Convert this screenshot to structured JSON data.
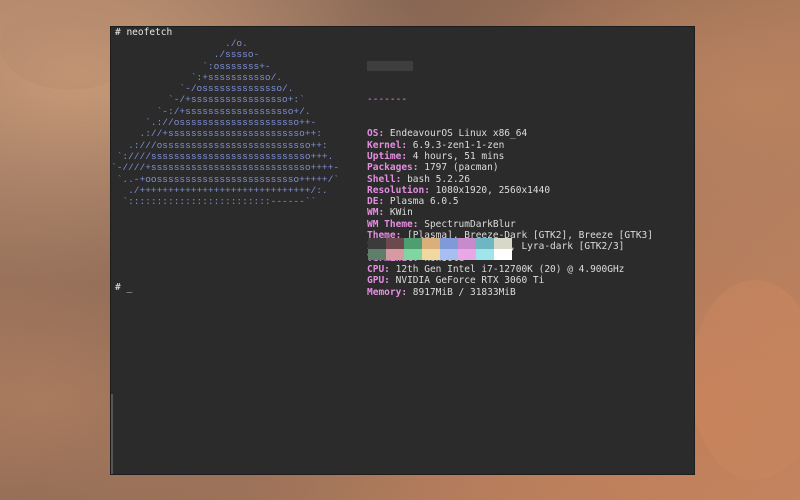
{
  "terminal": {
    "command_line": "# neofetch",
    "prompt_line": "# _"
  },
  "ascii_logo": "                    ./o.\n                  ./sssso-\n                `:osssssss+-\n              `:+sssssssssso/.\n            `-/ossssssssssssso/.\n          `-/+sssssssssssssssso+:`\n        `-:/+sssssssssssssssssso+/.\n      `.://osssssssssssssssssssso++-\n     .://+ssssssssssssssssssssssso++:\n   .:///ossssssssssssssssssssssssso++:\n `:////ssssssssssssssssssssssssssso+++.\n`-////+ssssssssssssssssssssssssssso++++-\n `..-+oosssssssssssssssssssssssso+++++/`\n   ./++++++++++++++++++++++++++++++/:.\n  `:::::::::::::::::::::::::------``",
  "info": {
    "host_separator": "-------",
    "rows": [
      {
        "key": "OS",
        "value": "EndeavourOS Linux x86_64"
      },
      {
        "key": "Kernel",
        "value": "6.9.3-zen1-1-zen"
      },
      {
        "key": "Uptime",
        "value": "4 hours, 51 mins"
      },
      {
        "key": "Packages",
        "value": "1797 (pacman)"
      },
      {
        "key": "Shell",
        "value": "bash 5.2.26"
      },
      {
        "key": "Resolution",
        "value": "1080x1920, 2560x1440"
      },
      {
        "key": "DE",
        "value": "Plasma 6.0.5"
      },
      {
        "key": "WM",
        "value": "KWin"
      },
      {
        "key": "WM Theme",
        "value": "SpectrumDarkBlur"
      },
      {
        "key": "Theme",
        "value": "[Plasma], Breeze-Dark [GTK2], Breeze [GTK3]"
      },
      {
        "key": "Icons",
        "value": "Lyra-dark [Plasma], Lyra-dark [GTK2/3]"
      },
      {
        "key": "Terminal",
        "value": "konsole"
      },
      {
        "key": "CPU",
        "value": "12th Gen Intel i7-12700K (20) @ 4.900GHz"
      },
      {
        "key": "GPU",
        "value": "NVIDIA GeForce RTX 3060 Ti"
      },
      {
        "key": "Memory",
        "value": "8917MiB / 31833MiB"
      }
    ]
  },
  "palette": {
    "top": [
      "#3b3b3b",
      "#6b4a4e",
      "#4e9e72",
      "#d9b07a",
      "#7f9ad6",
      "#c98acb",
      "#6fb6c3",
      "#d8d8c8"
    ],
    "bottom": [
      "#5f7f6a",
      "#d69aa0",
      "#7fd6a0",
      "#f0d8a0",
      "#a6bff0",
      "#e8a8e8",
      "#a0e4ec",
      "#ffffff"
    ]
  },
  "colors": {
    "terminal_bg": "#2b2b2b",
    "key": "#e58ee1",
    "logo": "#7f90d6"
  }
}
